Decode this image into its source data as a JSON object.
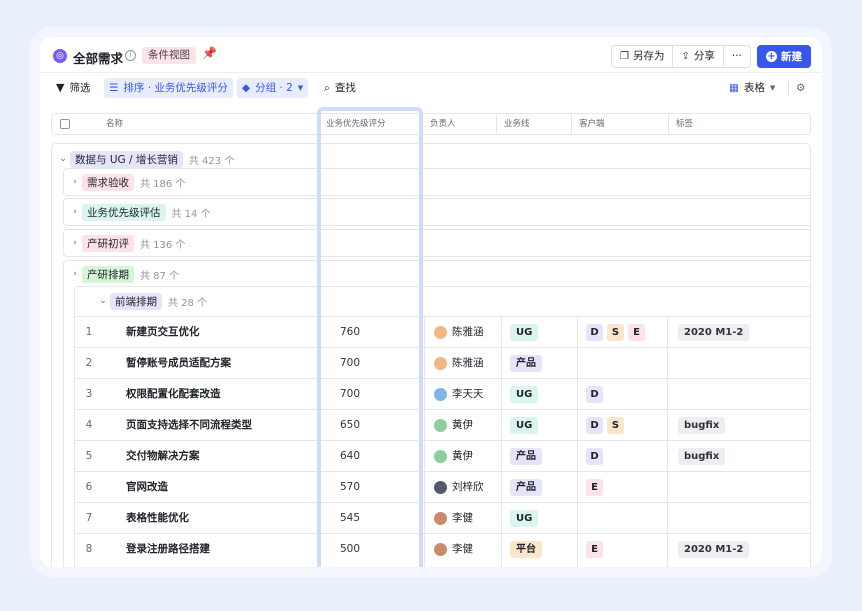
{
  "header": {
    "title": "全部需求",
    "view_tag": "条件视图",
    "save_as": "另存为",
    "share": "分享",
    "more": "···",
    "new": "新建"
  },
  "toolbar": {
    "filter": "筛选",
    "sort": "排序 · 业务优先级评分",
    "group": "分组 · 2",
    "find": "查找",
    "view": "表格"
  },
  "columns": [
    "名称",
    "业务优先级评分",
    "负责人",
    "业务线",
    "客户端",
    "标签"
  ],
  "groups": [
    {
      "label": "数据与 UG / 增长营销",
      "count": "共 423 个",
      "color": "#e6e4fb"
    },
    {
      "label": "需求验收",
      "count": "共 186 个",
      "color": "#fde2ea"
    },
    {
      "label": "业务优先级评估",
      "count": "共 14 个",
      "color": "#d9f5ee"
    },
    {
      "label": "产研初评",
      "count": "共 136 个",
      "color": "#fde2ea"
    },
    {
      "label": "产研排期",
      "count": "共 87 个",
      "color": "#d6f5d6"
    },
    {
      "label": "前端排期",
      "count": "共 28 个",
      "color": "#e6e4fb"
    }
  ],
  "rows": [
    {
      "n": "1",
      "name": "新建页交互优化",
      "score": "760",
      "owner": "陈雅涵",
      "line": "UG",
      "clients": [
        "D",
        "S",
        "E"
      ],
      "tag": "2020 M1-2"
    },
    {
      "n": "2",
      "name": "暂停账号成员适配方案",
      "score": "700",
      "owner": "陈雅涵",
      "line": "产品",
      "clients": [],
      "tag": ""
    },
    {
      "n": "3",
      "name": "权限配置化配套改造",
      "score": "700",
      "owner": "李天天",
      "line": "UG",
      "clients": [
        "D"
      ],
      "tag": ""
    },
    {
      "n": "4",
      "name": "页面支持选择不同流程类型",
      "score": "650",
      "owner": "黄伊",
      "line": "UG",
      "clients": [
        "D",
        "S"
      ],
      "tag": "bugfix"
    },
    {
      "n": "5",
      "name": "交付物解决方案",
      "score": "640",
      "owner": "黄伊",
      "line": "产品",
      "clients": [
        "D"
      ],
      "tag": "bugfix"
    },
    {
      "n": "6",
      "name": "官网改造",
      "score": "570",
      "owner": "刘梓欣",
      "line": "产品",
      "clients": [
        "E"
      ],
      "tag": ""
    },
    {
      "n": "7",
      "name": "表格性能优化",
      "score": "545",
      "owner": "李健",
      "line": "UG",
      "clients": [],
      "tag": ""
    },
    {
      "n": "8",
      "name": "登录注册路径搭建",
      "score": "500",
      "owner": "李健",
      "line": "平台",
      "clients": [
        "E"
      ],
      "tag": "2020 M1-2"
    }
  ]
}
